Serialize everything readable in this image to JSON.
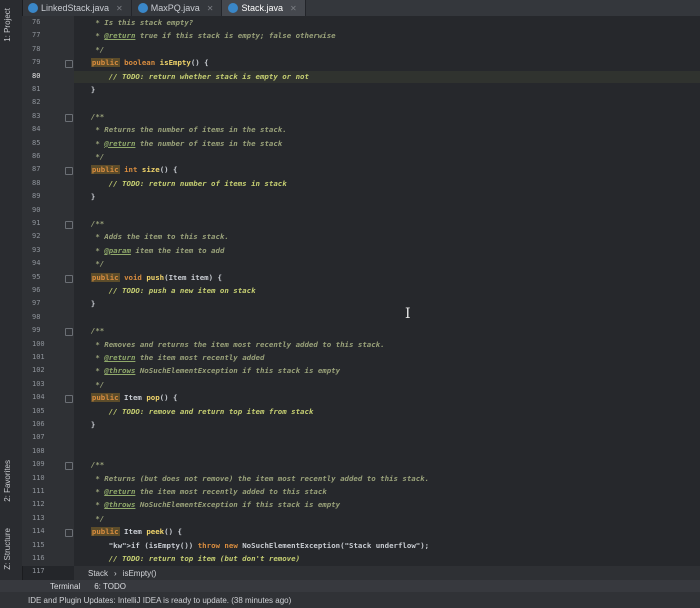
{
  "tabs": [
    {
      "label": "LinkedStack.java",
      "active": false
    },
    {
      "label": "MaxPQ.java",
      "active": false
    },
    {
      "label": "Stack.java",
      "active": true
    }
  ],
  "sidebar": {
    "project_label": "1: Project",
    "favorites_label": "2: Favorites",
    "structure_label": "Z: Structure"
  },
  "lines": [
    {
      "n": "76",
      "text": "   * Is this stack empty?",
      "kind": "cm"
    },
    {
      "n": "77",
      "text": "   * @return true if this stack is empty; false otherwise",
      "kind": "doc"
    },
    {
      "n": "78",
      "text": "   */",
      "kind": "cm"
    },
    {
      "n": "79",
      "text": "  public boolean isEmpty() {",
      "kind": "sig"
    },
    {
      "n": "80",
      "text": "      // TODO: return whether stack is empty or not",
      "kind": "todo"
    },
    {
      "n": "81",
      "text": "  }",
      "kind": "plain"
    },
    {
      "n": "82",
      "text": "",
      "kind": "plain"
    },
    {
      "n": "83",
      "text": "  /**",
      "kind": "cm"
    },
    {
      "n": "84",
      "text": "   * Returns the number of items in the stack.",
      "kind": "cm"
    },
    {
      "n": "85",
      "text": "   * @return the number of items in the stack",
      "kind": "doc"
    },
    {
      "n": "86",
      "text": "   */",
      "kind": "cm"
    },
    {
      "n": "87",
      "text": "  public int size() {",
      "kind": "sig"
    },
    {
      "n": "88",
      "text": "      // TODO: return number of items in stack",
      "kind": "todo"
    },
    {
      "n": "89",
      "text": "  }",
      "kind": "plain"
    },
    {
      "n": "90",
      "text": "",
      "kind": "plain"
    },
    {
      "n": "91",
      "text": "  /**",
      "kind": "cm"
    },
    {
      "n": "92",
      "text": "   * Adds the item to this stack.",
      "kind": "cm"
    },
    {
      "n": "93",
      "text": "   * @param item the item to add",
      "kind": "doc"
    },
    {
      "n": "94",
      "text": "   */",
      "kind": "cm"
    },
    {
      "n": "95",
      "text": "  public void push(Item item) {",
      "kind": "sig"
    },
    {
      "n": "96",
      "text": "      // TODO: push a new item on stack",
      "kind": "todo"
    },
    {
      "n": "97",
      "text": "  }",
      "kind": "plain"
    },
    {
      "n": "98",
      "text": "",
      "kind": "plain"
    },
    {
      "n": "99",
      "text": "  /**",
      "kind": "cm"
    },
    {
      "n": "100",
      "text": "   * Removes and returns the item most recently added to this stack.",
      "kind": "cm"
    },
    {
      "n": "101",
      "text": "   * @return the item most recently added",
      "kind": "doc"
    },
    {
      "n": "102",
      "text": "   * @throws NoSuchElementException if this stack is empty",
      "kind": "doc"
    },
    {
      "n": "103",
      "text": "   */",
      "kind": "cm"
    },
    {
      "n": "104",
      "text": "  public Item pop() {",
      "kind": "sig"
    },
    {
      "n": "105",
      "text": "      // TODO: remove and return top item from stack",
      "kind": "todo"
    },
    {
      "n": "106",
      "text": "  }",
      "kind": "plain"
    },
    {
      "n": "107",
      "text": "",
      "kind": "plain"
    },
    {
      "n": "108",
      "text": "",
      "kind": "plain"
    },
    {
      "n": "109",
      "text": "  /**",
      "kind": "cm"
    },
    {
      "n": "110",
      "text": "   * Returns (but does not remove) the item most recently added to this stack.",
      "kind": "cm"
    },
    {
      "n": "111",
      "text": "   * @return the item most recently added to this stack",
      "kind": "doc"
    },
    {
      "n": "112",
      "text": "   * @throws NoSuchElementException if this stack is empty",
      "kind": "doc"
    },
    {
      "n": "113",
      "text": "   */",
      "kind": "cm"
    },
    {
      "n": "114",
      "text": "  public Item peek() {",
      "kind": "sig"
    },
    {
      "n": "115",
      "text": "      if (isEmpty()) throw new NoSuchElementException(\"Stack underflow\");",
      "kind": "throw"
    },
    {
      "n": "116",
      "text": "      // TODO: return top item (but don't remove)",
      "kind": "todo"
    },
    {
      "n": "117",
      "text": "  }",
      "kind": "plain"
    }
  ],
  "breadcrumb": {
    "items": [
      "Stack",
      "isEmpty()"
    ]
  },
  "bottom_tools": {
    "terminal": "Terminal",
    "todo": "6: TODO"
  },
  "status": {
    "message": "IDE and Plugin Updates: IntelliJ IDEA is ready to update. (38 minutes ago)"
  },
  "colors": {
    "keyword": "#d88c3f",
    "comment": "#9aa27a",
    "todo": "#c6cf72",
    "method": "#f0d46a",
    "string": "#7fb56a"
  }
}
